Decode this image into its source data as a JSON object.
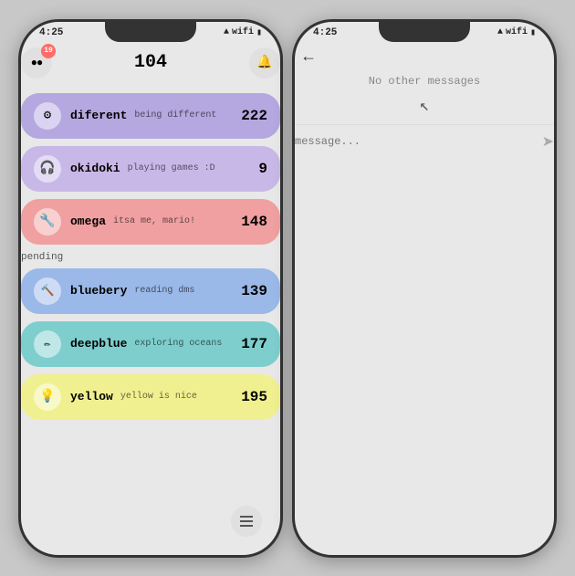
{
  "phone1": {
    "status_bar": {
      "time": "4:25",
      "icons": "wifi signal battery"
    },
    "header": {
      "badge_count": "19",
      "total_count": "104",
      "menu_icon": "☰",
      "bell_icon": "🔔"
    },
    "contacts": [
      {
        "id": "diferent",
        "name": "diferent",
        "status": "being different",
        "score": "222",
        "color": "purple",
        "icon": "⚙️"
      },
      {
        "id": "okidoki",
        "name": "okidoki",
        "status": "playing games :D",
        "score": "9",
        "color": "lavender",
        "icon": "🎧"
      },
      {
        "id": "omega",
        "name": "omega",
        "status": "itsa me, mario!",
        "score": "148",
        "color": "pink",
        "icon": "🔧"
      }
    ],
    "pending_label": "pending",
    "pending_contacts": [
      {
        "id": "bluebery",
        "name": "bluebery",
        "status": "reading dms",
        "score": "139",
        "color": "blue-light",
        "icon": "🔨"
      },
      {
        "id": "deepblue",
        "name": "deepblue",
        "status": "exploring oceans",
        "score": "177",
        "color": "teal",
        "icon": "✏️"
      },
      {
        "id": "yellow",
        "name": "yellow",
        "status": "yellow is nice",
        "score": "195",
        "color": "yellow",
        "icon": "💡"
      }
    ]
  },
  "phone2": {
    "status_bar": {
      "time": "4:25",
      "icons": "wifi signal battery"
    },
    "back_label": "←",
    "no_messages_text": "No other messages",
    "input_placeholder": "message...",
    "send_icon": "➤",
    "cursor_icon": "↖"
  }
}
